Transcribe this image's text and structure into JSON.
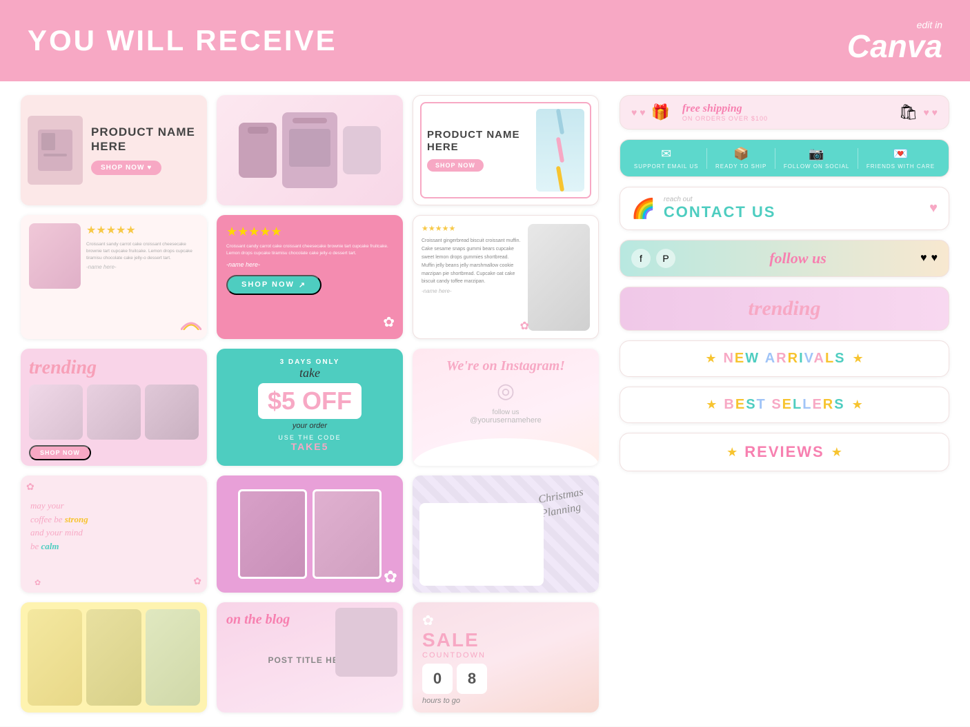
{
  "header": {
    "title": "YOU WILL RECEIVE",
    "logo_edit": "edit in",
    "logo_canva": "Canva"
  },
  "cards": {
    "card1": {
      "product_name": "PRODUCT NAME HERE",
      "shop_btn": "SHOP NOW"
    },
    "card3": {
      "product_name": "PRODUCT NAME HERE",
      "shop_btn": "SHOP NOW"
    },
    "card5": {
      "shop_btn": "SHOP NOW",
      "review_text": "Croissant candy carrot cake croissant cheesecake brownie tart cupcake fruitcake. Lemon drops cupcake tiramisu chocolate cake jelly-o dessert tart.",
      "name_here": "-name here-"
    },
    "card6": {
      "review_text": "Croissant gingerbread biscuit croissant muffin. Cake sesame snaps gummi bears cupcake sweet lemon drops gummies shortbread. Muffin jelly beans jelly marshmallow cookie marzipan pie shortbread. Cupcake oat cake biscuit candy toffee marzipan.",
      "name_here": "-name here-"
    },
    "card7": {
      "title": "trending",
      "shop_btn": "SHOP NOW"
    },
    "card8": {
      "days_only": "3 DAYS ONLY",
      "take": "take",
      "discount": "$5 OFF",
      "your_order": "your order",
      "use_code": "USE THE CODE",
      "code": "TAKE5"
    },
    "card9": {
      "title": "We're on Instagram!",
      "follow": "follow us",
      "username": "@yourusernamehere"
    },
    "card10": {
      "line1": "may your",
      "line2": "coffee be",
      "strong": "strong",
      "line3": "and your mind",
      "line4": "be",
      "calm": "calm"
    },
    "card14": {
      "title": "on the blog",
      "post_title": "POST TITLE HERE"
    },
    "card15": {
      "sale": "SALE",
      "countdown": "COUNTDOWN",
      "num1": "0",
      "num2": "8",
      "hours": "hours to go"
    }
  },
  "sidebar": {
    "shipping": {
      "title": "free shipping",
      "subtitle": "ON ORDERS OVER $100"
    },
    "teal_items": [
      {
        "icon": "✉",
        "label": "SUPPORT EMAIL US"
      },
      {
        "icon": "📦",
        "label": "READY TO SHIP"
      },
      {
        "icon": "📷",
        "label": "FOLLOW ON SOCIAL"
      },
      {
        "icon": "💌",
        "label": "FRIENDS WITH CARE"
      }
    ],
    "contact": {
      "reach_out": "reach out",
      "text": "CONTACT US"
    },
    "follow": {
      "text": "follow us"
    },
    "trending": {
      "text": "trending"
    },
    "new_arrivals": {
      "text": "NEW ARRIVALS"
    },
    "best_sellers": {
      "text": "BEST SELLERS"
    },
    "reviews": {
      "text": "REVIEWS"
    }
  }
}
